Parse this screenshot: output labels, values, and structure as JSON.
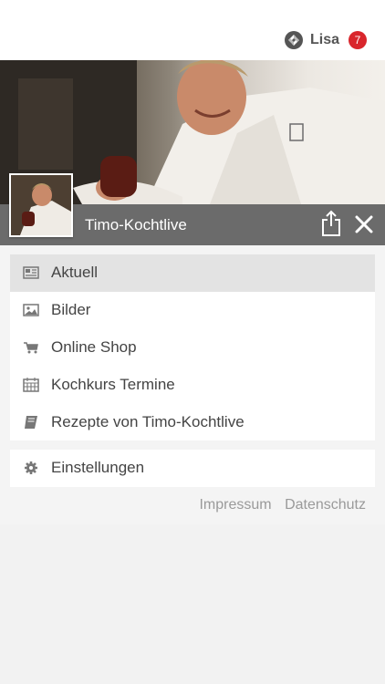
{
  "header": {
    "user_name": "Lisa",
    "notification_count": "7"
  },
  "hero": {
    "title": "Timo-Kochtlive"
  },
  "menu": {
    "items": [
      {
        "label": "Aktuell",
        "icon": "newspaper-icon",
        "active": true
      },
      {
        "label": "Bilder",
        "icon": "image-icon",
        "active": false
      },
      {
        "label": "Online Shop",
        "icon": "cart-icon",
        "active": false
      },
      {
        "label": "Kochkurs Termine",
        "icon": "calendar-icon",
        "active": false
      },
      {
        "label": "Rezepte von Timo-Kochtlive",
        "icon": "book-icon",
        "active": false
      }
    ],
    "settings_label": "Einstellungen"
  },
  "footer": {
    "impressum": "Impressum",
    "datenschutz": "Datenschutz"
  },
  "colors": {
    "badge": "#d9262c",
    "hero_bar": "#6b6b6b",
    "active_item": "#e3e3e3"
  }
}
